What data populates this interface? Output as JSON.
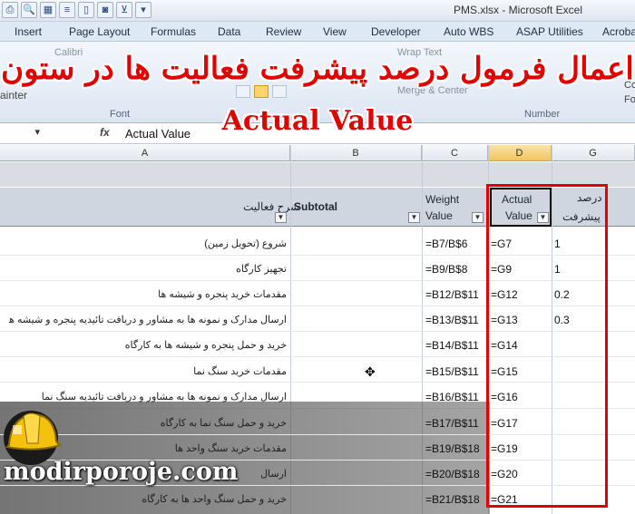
{
  "window": {
    "title": "PMS.xlsx - Microsoft Excel"
  },
  "ribbon_tabs": [
    "Insert",
    "Page Layout",
    "Formulas",
    "Data",
    "Review",
    "View",
    "Developer",
    "Auto WBS",
    "ASAP Utilities",
    "Acroba"
  ],
  "ribbon": {
    "font_group": "Font",
    "number_group": "Number",
    "painter": "ainter",
    "font_name": "Calibri",
    "wrap_text": "Wrap Text",
    "merge_center": "Merge & Center",
    "co_left": "Co",
    "co_right": "Fo"
  },
  "overlay": {
    "title_fa": "اعمال فرمول درصد پیشرفت فعالیت ها در ستون",
    "title_en": "Actual Value"
  },
  "formula_bar": {
    "fx": "fx",
    "content": "Actual Value"
  },
  "columns": {
    "a": "A",
    "b": "B",
    "c": "C",
    "d": "D",
    "g": "G"
  },
  "table_header": {
    "activity": "شرح فعالیت",
    "subtotal": "Subtotal",
    "weight_1": "Weight",
    "weight_2": "Value",
    "actual_1": "Actual",
    "actual_2": "Value",
    "progress_1": "درصد",
    "progress_2": "پیشرفت"
  },
  "rows": [
    {
      "activity": "شروع (تحویل زمین)",
      "weight": "=B7/B$6",
      "actual": "=G7",
      "progress": "1"
    },
    {
      "activity": "تجهیز کارگاه",
      "weight": "=B9/B$8",
      "actual": "=G9",
      "progress": "1"
    },
    {
      "activity": "مقدمات خرید پنجره و شیشه ها",
      "weight": "=B12/B$11",
      "actual": "=G12",
      "progress": "0.2"
    },
    {
      "activity": "ارسال مدارک و نمونه ها به مشاور و دریافت تائیدیه پنجره و شیشه ها",
      "weight": "=B13/B$11",
      "actual": "=G13",
      "progress": "0.3"
    },
    {
      "activity": "خرید و حمل پنجره و شیشه ها به کارگاه",
      "weight": "=B14/B$11",
      "actual": "=G14",
      "progress": ""
    },
    {
      "activity": "مقدمات خرید سنگ نما",
      "weight": "=B15/B$11",
      "actual": "=G15",
      "progress": ""
    },
    {
      "activity": "ارسال مدارک و نمونه ها به مشاور و دریافت تائیدیه سنگ نما",
      "weight": "=B16/B$11",
      "actual": "=G16",
      "progress": ""
    },
    {
      "activity": "خرید و حمل سنگ نما به کارگاه",
      "weight": "=B17/B$11",
      "actual": "=G17",
      "progress": ""
    },
    {
      "activity": "مقدمات خرید سنگ واحد ها",
      "weight": "=B19/B$18",
      "actual": "=G19",
      "progress": ""
    },
    {
      "activity": "ارسال",
      "weight": "=B20/B$18",
      "actual": "=G20",
      "progress": ""
    },
    {
      "activity": "خرید و حمل سنگ واحد ها به کارگاه",
      "weight": "=B21/B$18",
      "actual": "=G21",
      "progress": ""
    }
  ],
  "watermark": "modirporoje.com",
  "colors": {
    "highlight": "#e00000",
    "title": "#e10000"
  }
}
